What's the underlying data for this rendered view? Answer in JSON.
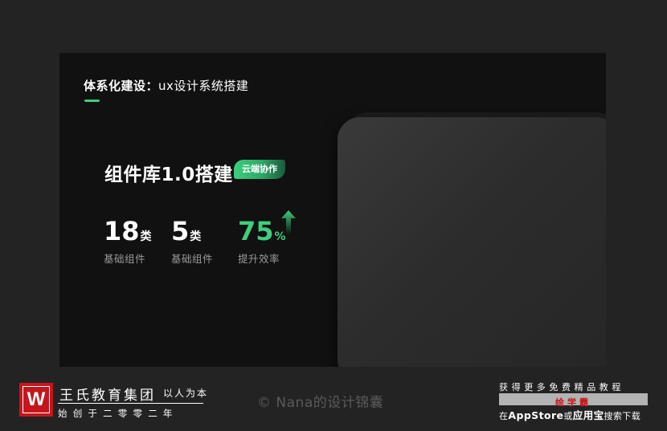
{
  "slide": {
    "title_bold": "体系化建设：",
    "title_rest": "ux设计系统搭建",
    "accent_color": "#3ecf7e"
  },
  "library": {
    "title": "组件库1.0搭建",
    "tag": "云端协作"
  },
  "stats": [
    {
      "value": "18",
      "unit": "类",
      "label": "基础组件"
    },
    {
      "value": "5",
      "unit": "类",
      "label": "基础组件"
    },
    {
      "value": "75",
      "unit": "%",
      "label": "提升效率",
      "icon": "arrow-up-icon"
    }
  ],
  "footer": {
    "logo_letter": "W",
    "org_name": "王氏教育集团",
    "motto": "以人为本",
    "founded": "始创于二零零二年",
    "copyright": "© Nana的设计锦囊",
    "promo_top": "获得更多免费精品教程",
    "promo_app": "绘学霸",
    "promo_bottom_prefix": "在",
    "promo_bottom_store": "AppStore",
    "promo_bottom_or": "或",
    "promo_bottom_market": "应用宝",
    "promo_bottom_suffix": "搜索下载",
    "brand_color": "#c4161c"
  }
}
